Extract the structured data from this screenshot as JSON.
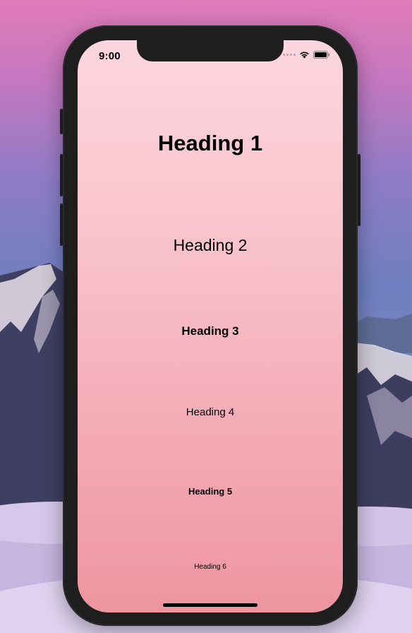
{
  "status_bar": {
    "time": "9:00",
    "wifi_icon": "wifi-icon",
    "battery_icon": "battery-icon"
  },
  "headings": {
    "h1": "Heading 1",
    "h2": "Heading 2",
    "h3": "Heading 3",
    "h4": "Heading 4",
    "h5": "Heading 5",
    "h6": "Heading 6"
  },
  "colors": {
    "screen_gradient_top": "#fdd6df",
    "screen_gradient_bottom": "#ee959f",
    "phone_frame": "#1e1e1f",
    "text": "#000000"
  }
}
